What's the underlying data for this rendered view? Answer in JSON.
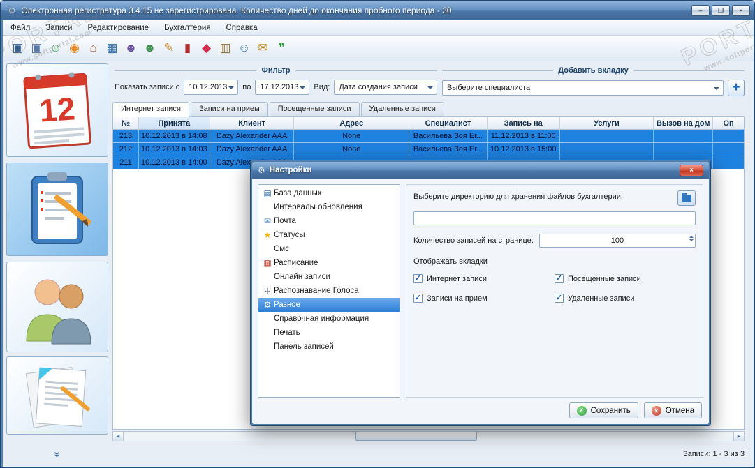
{
  "window": {
    "title": "Электронная регистратура 3.4.15 не зарегистрирована. Количество дней до окончания пробного периода - 30",
    "controls": {
      "minimize": "–",
      "maximize": "❐",
      "close": "×"
    },
    "app_icon_glyph": "☺"
  },
  "menu": {
    "items": [
      {
        "label": "Файл"
      },
      {
        "label": "Записи"
      },
      {
        "label": "Редактирование"
      },
      {
        "label": "Бухгалтерия"
      },
      {
        "label": "Справка"
      }
    ]
  },
  "toolbar": {
    "icons": [
      {
        "name": "save-icon",
        "glyph": "▣"
      },
      {
        "name": "save-all-icon",
        "glyph": "▣"
      },
      {
        "name": "add-client-icon",
        "glyph": "☺"
      },
      {
        "name": "new-record-icon",
        "glyph": "◉"
      },
      {
        "name": "home-icon",
        "glyph": "⌂"
      },
      {
        "name": "schedule-icon",
        "glyph": "▦"
      },
      {
        "name": "meeting-icon",
        "glyph": "☻"
      },
      {
        "name": "clients-icon",
        "glyph": "☻"
      },
      {
        "name": "edit-record-icon",
        "glyph": "✎"
      },
      {
        "name": "journal-icon",
        "glyph": "▮"
      },
      {
        "name": "gift-icon",
        "glyph": "◆"
      },
      {
        "name": "archive-icon",
        "glyph": "▥"
      },
      {
        "name": "specialist-icon",
        "glyph": "☺"
      },
      {
        "name": "mail-icon",
        "glyph": "✉"
      },
      {
        "name": "chat-icon",
        "glyph": "❞"
      }
    ]
  },
  "watermark": {
    "big": "PORTAL",
    "small": "www.softportal.com"
  },
  "sidebar": {
    "calendar_day": "12",
    "collapse_glyph": "»"
  },
  "filter": {
    "group_label": "Фильтр",
    "show_records_label": "Показать записи с",
    "date_from": "10.12.2013",
    "to_label": "по",
    "date_to": "17.12.2013",
    "view_label": "Вид:",
    "view_value": "Дата создания записи"
  },
  "add_tab": {
    "group_label": "Добавить вкладку",
    "specialist_value": "Выберите специалиста",
    "plus_glyph": "+"
  },
  "tabs": [
    {
      "label": "Интернет записи",
      "active": true
    },
    {
      "label": "Записи на прием",
      "active": false
    },
    {
      "label": "Посещенные записи",
      "active": false
    },
    {
      "label": "Удаленные записи",
      "active": false
    }
  ],
  "table": {
    "columns": [
      "№",
      "Принята",
      "Клиент",
      "Адрес",
      "Специалист",
      "Запись на",
      "Услуги",
      "Вызов на дом",
      "Оп"
    ],
    "rows": [
      {
        "cells": [
          "213",
          "10.12.2013 в 14:08",
          "Dazy Alexander AAA",
          "None",
          "Васильева Зоя Ег...",
          "11.12.2013 в 11:00",
          "",
          "",
          ""
        ]
      },
      {
        "cells": [
          "212",
          "10.12.2013 в 14:03",
          "Dazy Alexander AAA",
          "None",
          "Васильева Зоя Ег...",
          "10.12.2013 в 15:00",
          "",
          "",
          ""
        ]
      },
      {
        "cells": [
          "211",
          "10.12.2013 в 14:00",
          "Dazy Alexander AAA",
          "",
          "",
          "",
          "",
          "",
          ""
        ]
      }
    ]
  },
  "scrollbar": {
    "left": "◂",
    "right": "▸"
  },
  "status": {
    "records": "Записи: 1 - 3 из 3"
  },
  "dialog": {
    "title": "Настройки",
    "title_icon_glyph": "⚙",
    "close": "×",
    "list": [
      {
        "label": "База данных",
        "glyph": "▤"
      },
      {
        "label": "Интервалы обновления",
        "glyph": ""
      },
      {
        "label": "Почта",
        "glyph": "✉"
      },
      {
        "label": "Статусы",
        "glyph": "★"
      },
      {
        "label": "Смс",
        "glyph": ""
      },
      {
        "label": "Расписание",
        "glyph": "▦"
      },
      {
        "label": "Онлайн записи",
        "glyph": ""
      },
      {
        "label": "Распознавание Голоса",
        "glyph": "Ψ"
      },
      {
        "label": "Разное",
        "glyph": "⚙",
        "selected": true
      },
      {
        "label": "Справочная информация",
        "glyph": ""
      },
      {
        "label": "Печать",
        "glyph": ""
      },
      {
        "label": "Панель записей",
        "glyph": ""
      }
    ],
    "directory_label": "Выберите директорию для хранения файлов бухгалтерии:",
    "directory_value": "",
    "records_per_page_label": "Количество записей на странице:",
    "records_per_page_value": "100",
    "display_tabs_label": "Отображать вкладки",
    "checkmark_glyph": "✓",
    "checkboxes": [
      {
        "label": "Интернет записи",
        "checked": true
      },
      {
        "label": "Записи на прием",
        "checked": true
      },
      {
        "label": "Посещенные записи",
        "checked": true
      },
      {
        "label": "Удаленные записи",
        "checked": true
      }
    ],
    "save_icon_glyph": "✓",
    "cancel_icon_glyph": "×",
    "save_button": "Сохранить",
    "cancel_button": "Отмена"
  },
  "colors": {
    "titlebar": "#5d8cc0",
    "selected_row": "#1e82e0",
    "list_selection": "#2f7fd6",
    "save_green": "#2f9e3f",
    "cancel_red": "#c0392b"
  }
}
